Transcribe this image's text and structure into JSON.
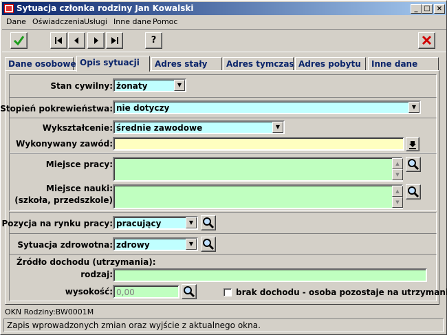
{
  "window": {
    "title": "Sytuacja członka rodziny Jan Kowalski"
  },
  "menu": [
    "Dane",
    "Oświadczenia",
    "Usługi",
    "Inne dane",
    "Pomoc"
  ],
  "toolbar": {
    "help": "?"
  },
  "tabs": [
    {
      "label": "Dane osobowe"
    },
    {
      "label": "Opis sytuacji"
    },
    {
      "label": "Adres stały"
    },
    {
      "label": "Adres tymczas."
    },
    {
      "label": "Adres pobytu"
    },
    {
      "label": "Inne dane"
    }
  ],
  "form": {
    "stan_cywilny": {
      "label": "Stan cywilny:",
      "value": "żonaty"
    },
    "stopien": {
      "label": "Stopień pokrewieństwa:",
      "value": "nie dotyczy"
    },
    "wyksztalcenie": {
      "label": "Wykształcenie:",
      "value": "średnie zawodowe"
    },
    "zawod": {
      "label": "Wykonywany zawód:",
      "value": ""
    },
    "miejsce_pracy": {
      "label": "Miejsce pracy:",
      "value": ""
    },
    "miejsce_nauki": {
      "label1": "Miejsce nauki:",
      "label2": "(szkoła, przedszkole)",
      "value": ""
    },
    "pozycja": {
      "label": "Pozycja na rynku pracy:",
      "value": "pracujący"
    },
    "zdrowie": {
      "label": "Sytuacja zdrowotna:",
      "value": "zdrowy"
    },
    "dochod": {
      "header": "Źródło dochodu (utrzymania):",
      "rodzaj_label": "rodzaj:",
      "rodzaj_value": "",
      "wysokosc_label": "wysokość:",
      "wysokosc_value": "0,00",
      "brak_label": "brak dochodu - osoba pozostaje na utrzymaniu",
      "brak_checked": false
    }
  },
  "okn": "OKN Rodziny:BW0001M",
  "status": "Zapis wprowadzonych zmian oraz wyjście z aktualnego okna.",
  "colors": {
    "cyan": "#c0ffff",
    "yellow": "#ffffc0",
    "green": "#c0ffc0",
    "title_start": "#0a246a",
    "confirm": "#1a9c1a",
    "cancel": "#d00000"
  }
}
